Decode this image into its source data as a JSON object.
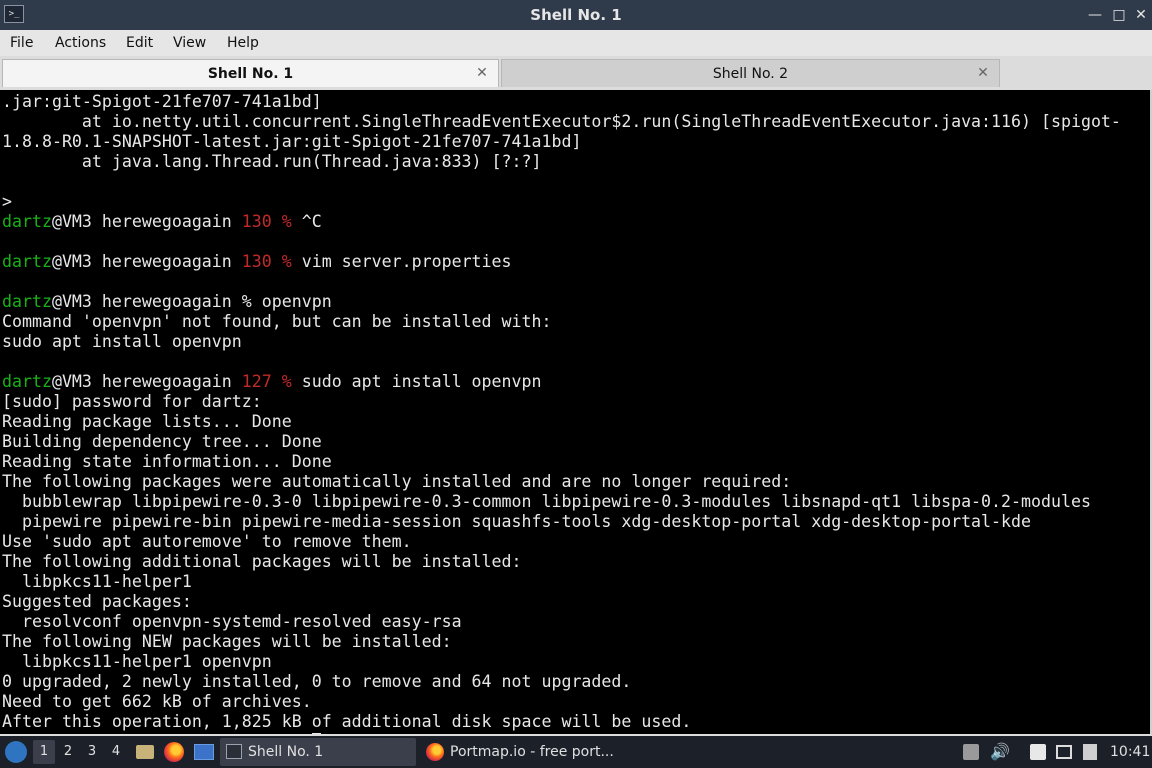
{
  "window": {
    "title": "Shell No. 1",
    "app_icon": "terminal-icon",
    "controls": [
      "minimize-icon",
      "maximize-icon",
      "close-icon"
    ]
  },
  "menubar": {
    "items": [
      "File",
      "Actions",
      "Edit",
      "View",
      "Help"
    ]
  },
  "tabs": [
    {
      "label": "Shell No. 1",
      "active": true
    },
    {
      "label": "Shell No. 2",
      "active": false
    }
  ],
  "terminal": {
    "background": "#000000",
    "prompt_user_color": "#18b218",
    "error_code_color": "#c22a2a",
    "lines": [
      [
        {
          "t": ".jar:git-Spigot-21fe707-741a1bd]"
        }
      ],
      [
        {
          "t": "        at io.netty.util.concurrent.SingleThreadEventExecutor$2.run(SingleThreadEventExecutor.java:116) [spigot-"
        }
      ],
      [
        {
          "t": "1.8.8-R0.1-SNAPSHOT-latest.jar:git-Spigot-21fe707-741a1bd]"
        }
      ],
      [
        {
          "t": "        at java.lang.Thread.run(Thread.java:833) [?:?]"
        }
      ],
      [
        {
          "t": ""
        }
      ],
      [
        {
          "t": ">"
        }
      ],
      [
        {
          "t": "dartz",
          "c": "g"
        },
        {
          "t": "@VM3 herewegoagain "
        },
        {
          "t": "130 %",
          "c": "r"
        },
        {
          "t": " ^C"
        }
      ],
      [
        {
          "t": ""
        }
      ],
      [
        {
          "t": "dartz",
          "c": "g"
        },
        {
          "t": "@VM3 herewegoagain "
        },
        {
          "t": "130 %",
          "c": "r"
        },
        {
          "t": " vim server.properties"
        }
      ],
      [
        {
          "t": ""
        }
      ],
      [
        {
          "t": "dartz",
          "c": "g"
        },
        {
          "t": "@VM3 herewegoagain % openvpn"
        }
      ],
      [
        {
          "t": "Command 'openvpn' not found, but can be installed with:"
        }
      ],
      [
        {
          "t": "sudo apt install openvpn"
        }
      ],
      [
        {
          "t": ""
        }
      ],
      [
        {
          "t": "dartz",
          "c": "g"
        },
        {
          "t": "@VM3 herewegoagain "
        },
        {
          "t": "127 %",
          "c": "r"
        },
        {
          "t": " sudo apt install openvpn"
        }
      ],
      [
        {
          "t": "[sudo] password for dartz:"
        }
      ],
      [
        {
          "t": "Reading package lists... Done"
        }
      ],
      [
        {
          "t": "Building dependency tree... Done"
        }
      ],
      [
        {
          "t": "Reading state information... Done"
        }
      ],
      [
        {
          "t": "The following packages were automatically installed and are no longer required:"
        }
      ],
      [
        {
          "t": "  bubblewrap libpipewire-0.3-0 libpipewire-0.3-common libpipewire-0.3-modules libsnapd-qt1 libspa-0.2-modules"
        }
      ],
      [
        {
          "t": "  pipewire pipewire-bin pipewire-media-session squashfs-tools xdg-desktop-portal xdg-desktop-portal-kde"
        }
      ],
      [
        {
          "t": "Use 'sudo apt autoremove' to remove them."
        }
      ],
      [
        {
          "t": "The following additional packages will be installed:"
        }
      ],
      [
        {
          "t": "  libpkcs11-helper1"
        }
      ],
      [
        {
          "t": "Suggested packages:"
        }
      ],
      [
        {
          "t": "  resolvconf openvpn-systemd-resolved easy-rsa"
        }
      ],
      [
        {
          "t": "The following NEW packages will be installed:"
        }
      ],
      [
        {
          "t": "  libpkcs11-helper1 openvpn"
        }
      ],
      [
        {
          "t": "0 upgraded, 2 newly installed, 0 to remove and 64 not upgraded."
        }
      ],
      [
        {
          "t": "Need to get 662 kB of archives."
        }
      ],
      [
        {
          "t": "After this operation, 1,825 kB of additional disk space will be used."
        }
      ],
      [
        {
          "t": "Do you want to continue? [Y/n] "
        },
        {
          "cursor": true
        }
      ]
    ]
  },
  "taskbar": {
    "start_icon": "start-menu-icon",
    "workspaces": [
      "1",
      "2",
      "3",
      "4"
    ],
    "active_workspace": "1",
    "launchers": [
      "file-manager-icon",
      "firefox-icon",
      "show-desktop-icon"
    ],
    "tasks": [
      {
        "label": "Shell No. 1",
        "icon": "terminal-icon",
        "active": true
      },
      {
        "label": "Portmap.io - free port...",
        "icon": "firefox-icon",
        "active": false
      }
    ],
    "tray": [
      "removable-drive-icon",
      "volume-icon",
      "clipboard-icon",
      "network-icon",
      "notifications-icon"
    ],
    "clock": "10:41"
  }
}
